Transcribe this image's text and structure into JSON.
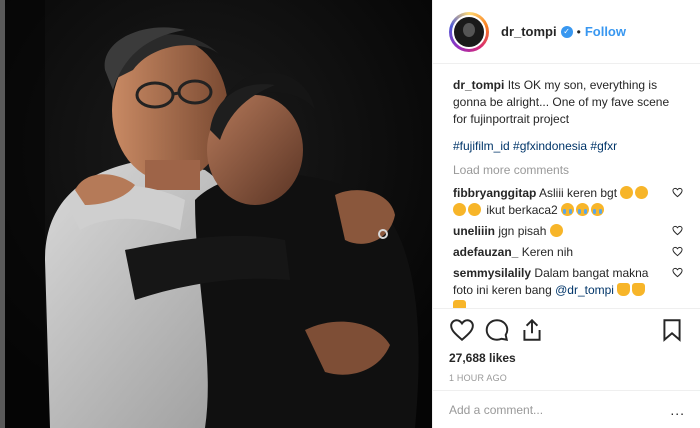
{
  "post": {
    "author": "dr_tompi",
    "verified": true,
    "follow_label": "Follow",
    "dot": "•",
    "caption_text": "Its OK my son, everything is gonna be alright... One of my fave scene for fujinportrait project",
    "hashtags": "#fujifilm_id #gfxindonesia #gfxr",
    "load_more": "Load more comments",
    "likes": "27,688 likes",
    "time": "1 HOUR AGO",
    "add_comment_placeholder": "Add a comment...",
    "more_options": "..."
  },
  "comments": [
    {
      "user": "fibbryanggitap",
      "text1": "Asliii keren bgt",
      "text2": "ikut berkaca2"
    },
    {
      "user": "uneliiin",
      "text": "jgn pisah"
    },
    {
      "user": "adefauzan_",
      "text": "Keren nih"
    },
    {
      "user": "semmysilalily",
      "text": "Dalam bangat makna foto ini keren bang",
      "mention": "@dr_tompi"
    }
  ],
  "icons": {
    "like": "heart-icon",
    "comment": "comment-icon",
    "share": "share-icon",
    "save": "bookmark-icon",
    "verified": "verified-badge-icon"
  },
  "colors": {
    "accent": "#3897f0",
    "link": "#003569",
    "muted": "#999999",
    "border": "#efefef"
  }
}
